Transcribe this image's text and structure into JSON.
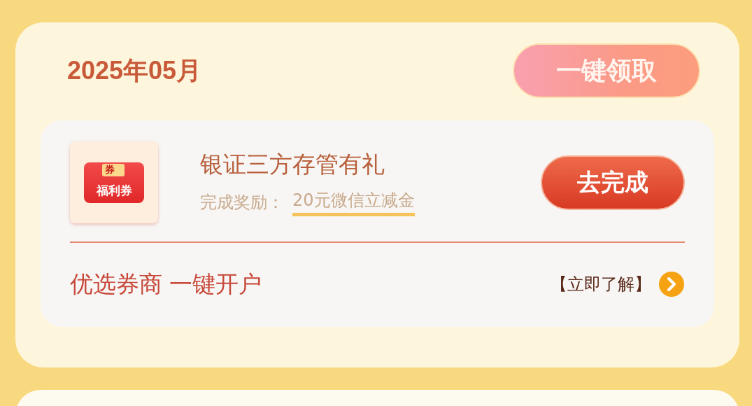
{
  "month_title": "2025年05月",
  "claim_all_button": "一键领取",
  "task": {
    "icon_badge": "券",
    "icon_label": "福利券",
    "title": "银证三方存管有礼",
    "reward_label": "完成奖励：",
    "reward_value": "20元微信立减金",
    "action_button": "去完成"
  },
  "footer": {
    "slogan": "优选券商 一键开户",
    "learn_more_link": "【立即了解】"
  }
}
